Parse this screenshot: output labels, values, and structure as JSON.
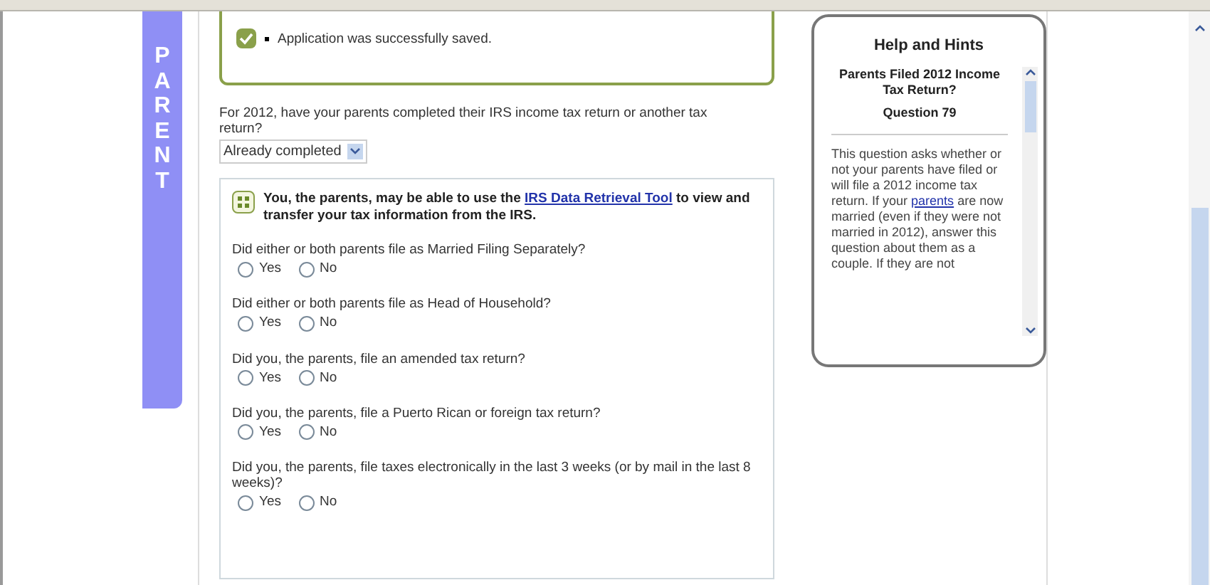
{
  "side_tab": {
    "label": "PARENT"
  },
  "notice": {
    "checked": true,
    "message": "Application was successfully saved."
  },
  "status_question": {
    "label": "For 2012, have your parents completed their IRS income tax return or another tax return?",
    "value": "Already completed"
  },
  "drt_box": {
    "text_before": "You, the parents, may be able to use the ",
    "link": "IRS Data Retrieval Tool",
    "text_after": " to view and transfer your tax information from the IRS.",
    "questions": [
      {
        "label": "Did either or both parents file as Married Filing Separately?",
        "options": [
          {
            "label": "Yes",
            "selected": false
          },
          {
            "label": "No",
            "selected": false
          }
        ]
      },
      {
        "label": "Did either or both parents file as Head of Household?",
        "options": [
          {
            "label": "Yes",
            "selected": false
          },
          {
            "label": "No",
            "selected": false
          }
        ]
      },
      {
        "label": "Did you, the parents, file an amended tax return?",
        "options": [
          {
            "label": "Yes",
            "selected": false
          },
          {
            "label": "No",
            "selected": false
          }
        ]
      },
      {
        "label": "Did you, the parents, file a Puerto Rican or foreign tax return?",
        "options": [
          {
            "label": "Yes",
            "selected": false
          },
          {
            "label": "No",
            "selected": false
          }
        ]
      },
      {
        "label": "Did you, the parents, file taxes electronically in the last 3 weeks (or by mail in the last 8 weeks)?",
        "options": [
          {
            "label": "Yes",
            "selected": false
          },
          {
            "label": "No",
            "selected": false
          }
        ]
      }
    ]
  },
  "help": {
    "title": "Help and Hints",
    "topic": "Parents Filed 2012 Income Tax Return?",
    "question": "Question 79",
    "text_before": "This question asks whether or not your parents have filed or will file a 2012 income tax return. If your ",
    "link": "parents",
    "text_after": " are now married (even if they were not married in 2012), answer this question about them as a couple. If they are not"
  }
}
